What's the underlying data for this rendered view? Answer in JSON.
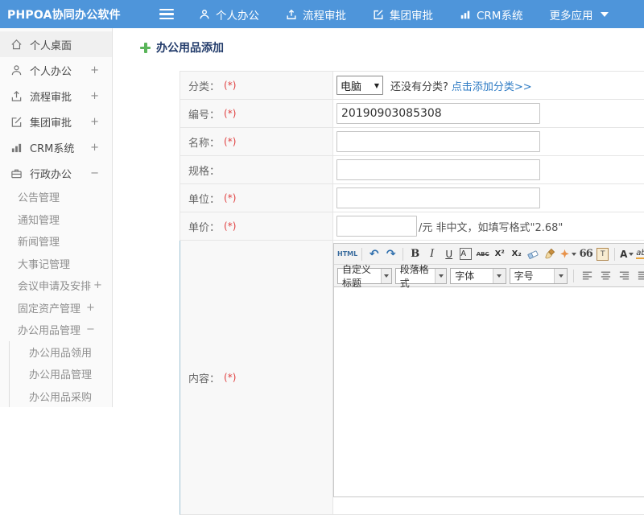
{
  "app": {
    "accent": "#4e95da",
    "link_color": "#2e7bc4",
    "required_color": "#e04040",
    "title_color": "#233c6b"
  },
  "topbar": {
    "logo": "PHPOA协同办公软件",
    "nav": [
      {
        "label": "个人办公"
      },
      {
        "label": "流程审批"
      },
      {
        "label": "集团审批"
      },
      {
        "label": "CRM系统"
      },
      {
        "label": "更多应用"
      }
    ]
  },
  "sidebar": {
    "items": [
      {
        "label": "个人桌面",
        "suffix": ""
      },
      {
        "label": "个人办公",
        "suffix": "+"
      },
      {
        "label": "流程审批",
        "suffix": "+"
      },
      {
        "label": "集团审批",
        "suffix": "+"
      },
      {
        "label": "CRM系统",
        "suffix": "+"
      },
      {
        "label": "行政办公",
        "suffix": "−"
      },
      {
        "label": "公告管理",
        "suffix": ""
      },
      {
        "label": "通知管理",
        "suffix": ""
      },
      {
        "label": "新闻管理",
        "suffix": ""
      },
      {
        "label": "大事记管理",
        "suffix": ""
      },
      {
        "label": "会议申请及安排",
        "suffix": "+"
      },
      {
        "label": "固定资产管理",
        "suffix": "+"
      },
      {
        "label": "办公用品管理",
        "suffix": "−"
      },
      {
        "label": "办公用品领用",
        "suffix": ""
      },
      {
        "label": "办公用品管理",
        "suffix": ""
      },
      {
        "label": "办公用品采购",
        "suffix": ""
      }
    ]
  },
  "page": {
    "title": "办公用品添加"
  },
  "form": {
    "rows": [
      {
        "label": "分类：",
        "req": "(*)"
      },
      {
        "label": "编号：",
        "req": "(*)"
      },
      {
        "label": "名称：",
        "req": "(*)"
      },
      {
        "label": "规格：",
        "req": ""
      },
      {
        "label": "单位：",
        "req": "(*)"
      },
      {
        "label": "单价：",
        "req": "(*)"
      },
      {
        "label": "内容：",
        "req": "(*)"
      }
    ],
    "category": {
      "selected": "电脑",
      "hint": "还没有分类?",
      "link": "点击添加分类>>"
    },
    "number_value": "20190903085308",
    "price_note": "/元 非中文，如填写格式\"2.68\""
  },
  "editor": {
    "source_label": "HTML",
    "undo_glyph": "↶",
    "redo_glyph": "↷",
    "bold": "B",
    "italic": "I",
    "underline": "U",
    "font_box": "A",
    "strike": "ABC",
    "superscript": "X²",
    "subscript": "X₂",
    "quote": "66",
    "fontcolor": "A",
    "highlight": "ab",
    "dropdowns": [
      "自定义标题",
      "段落格式",
      "字体",
      "字号"
    ]
  }
}
